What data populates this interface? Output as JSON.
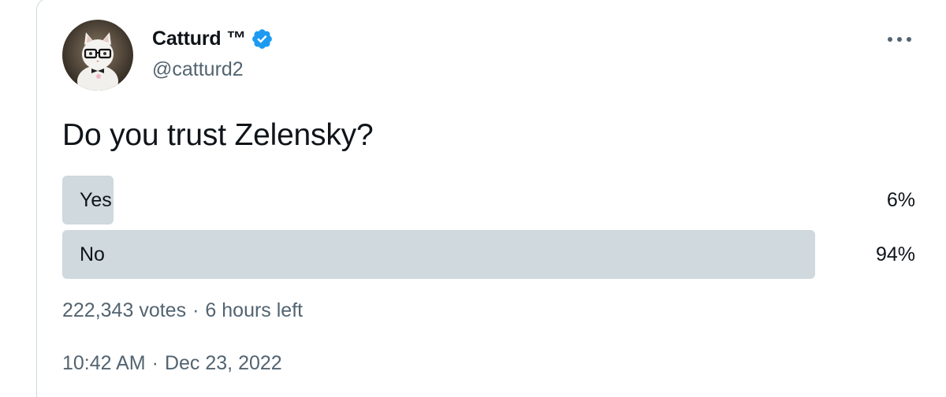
{
  "author": {
    "display_name": "Catturd ™",
    "handle": "@catturd2",
    "verified": true
  },
  "tweet": {
    "text": "Do you trust Zelensky?"
  },
  "poll": {
    "options": [
      {
        "label": "Yes",
        "percent_text": "6%",
        "fraction": 0.06
      },
      {
        "label": "No",
        "percent_text": "94%",
        "fraction": 0.94
      }
    ],
    "votes": "222,343 votes",
    "separator": "·",
    "time_left": "6 hours left"
  },
  "timestamp": {
    "time": "10:42 AM",
    "separator": "·",
    "date": "Dec 23, 2022"
  },
  "colors": {
    "verified_blue": "#1d9bf0",
    "poll_bar": "#cfd9de",
    "secondary_text": "#536471"
  },
  "icons": {
    "verified": "verified-badge-icon",
    "more": "more-options-icon"
  }
}
